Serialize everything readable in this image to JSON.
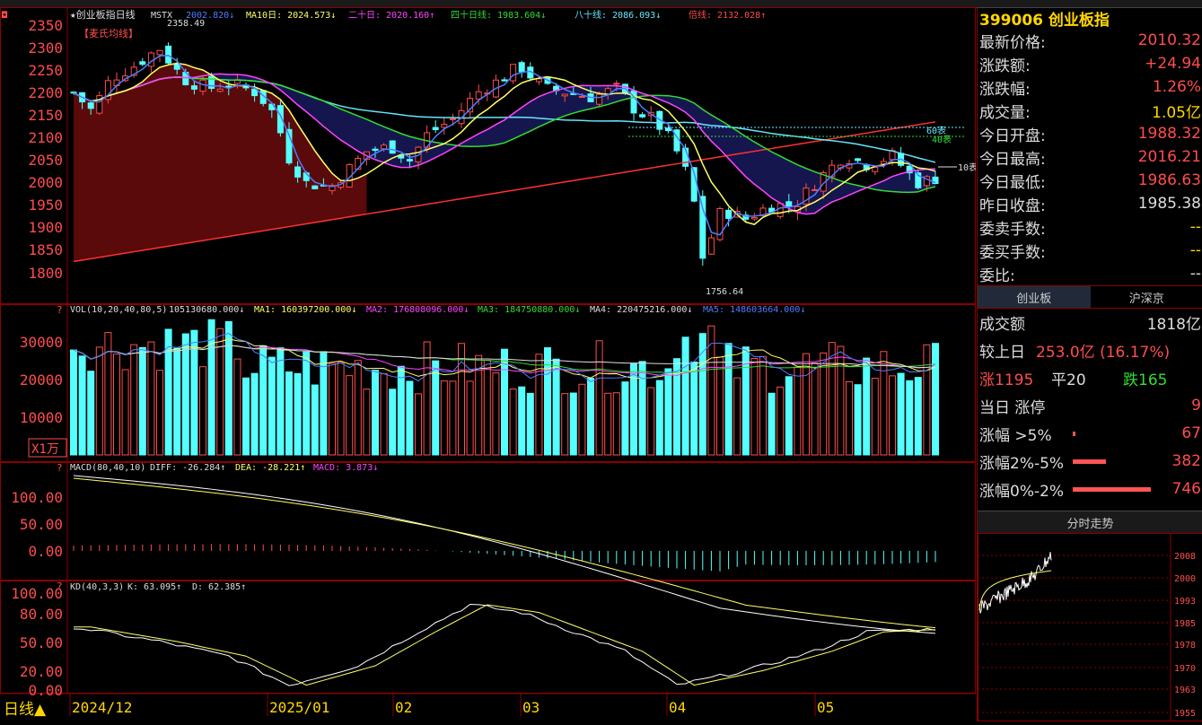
{
  "main_header": {
    "prefix": "★创业板指日线",
    "ma5": "MSTX",
    "ma10": "MA10日: 2024.573↓",
    "ma20": "二十日: 2020.160↑",
    "ma40": "四十日线: 1983.604↓",
    "ma80": "八十线: 2086.093↓",
    "ma_bei": "倍线: 2132.028↑",
    "ma5_val": "2002.820↓",
    "legend_label": "【麦氏均线】",
    "high_label": "2358.49",
    "low_label": "1756.64",
    "line_label_60": "60表",
    "line_label_40": "40表",
    "line_label_10": "10表"
  },
  "price_axis": [
    "2350",
    "2300",
    "2250",
    "2200",
    "2150",
    "2100",
    "2050",
    "2000",
    "1950",
    "1900",
    "1850",
    "1800"
  ],
  "vol_header": {
    "name": "VOL(10,20,40,80,5)",
    "v": "105130680.000↓",
    "ma1": "MA1: 160397200.000↓",
    "ma2": "MA2: 176808096.000↓",
    "ma3": "MA3: 184750880.000↓",
    "ma4": "MA4: 220475216.000↓",
    "ma5": "MA5: 148603664.000↓"
  },
  "vol_axis": [
    "30000",
    "20000",
    "10000"
  ],
  "vol_unit": "X1万",
  "macd_header": {
    "name": "MACD(80,40,10)",
    "diff": "DIFF: -26.284↑",
    "dea": "DEA: -28.221↑",
    "macd": "MACD: 3.873↓"
  },
  "macd_axis": [
    "100.00",
    "50.00",
    "0.00"
  ],
  "kd_header": {
    "name": "KD(40,3,3)",
    "k": "K: 63.095↑",
    "d": "D: 62.385↑"
  },
  "kd_axis": [
    "100.00",
    "80.00",
    "50.00",
    "20.00",
    "0.00"
  ],
  "date_axis": [
    "2024/12",
    "2025/01",
    "02",
    "03",
    "04",
    "05"
  ],
  "period_label": "日线▲",
  "index_title": "399006 创业板指",
  "quote": [
    {
      "label": "最新价格:",
      "value": "2010.32",
      "color": "#ff4d4d"
    },
    {
      "label": "涨跌额:",
      "value": "+24.94",
      "color": "#ff4d4d"
    },
    {
      "label": "涨跌幅:",
      "value": "1.26%",
      "color": "#ff4d4d"
    },
    {
      "label": "成交量:",
      "value": "1.05亿",
      "color": "#ffd700"
    },
    {
      "label": "今日开盘:",
      "value": "1988.32",
      "color": "#ff4d4d"
    },
    {
      "label": "今日最高:",
      "value": "2016.21",
      "color": "#ff4d4d"
    },
    {
      "label": "今日最低:",
      "value": "1986.63",
      "color": "#ff4d4d"
    },
    {
      "label": "昨日收盘:",
      "value": "1985.38",
      "color": "#dddddd"
    },
    {
      "label": "委卖手数:",
      "value": "--",
      "color": "#ffd700"
    },
    {
      "label": "委买手数:",
      "value": "--",
      "color": "#ffd700"
    },
    {
      "label": "委比:",
      "value": "--",
      "color": "#dddddd"
    }
  ],
  "tabs": [
    "创业板",
    "沪深京"
  ],
  "stats": {
    "turnover_label": "成交额",
    "turnover_value": "1818亿",
    "vs_yesterday_label": "较上日",
    "vs_yesterday_value": "253.0亿 (16.17%)",
    "up": "涨1195",
    "flat": "平20",
    "down": "跌165",
    "limit_up_label": "当日 涨停",
    "limit_up_value": "9",
    "buckets": [
      {
        "label": "涨幅 >5%",
        "value": "67",
        "fill": 0.03
      },
      {
        "label": "涨幅2%-5%",
        "value": "382",
        "fill": 0.4
      },
      {
        "label": "涨幅0%-2%",
        "value": "746",
        "fill": 0.95
      }
    ]
  },
  "mini_title": "分时走势",
  "mini_axis": [
    "2008",
    "2000",
    "1993",
    "1985",
    "1978",
    "1970",
    "1963",
    "1955"
  ]
}
